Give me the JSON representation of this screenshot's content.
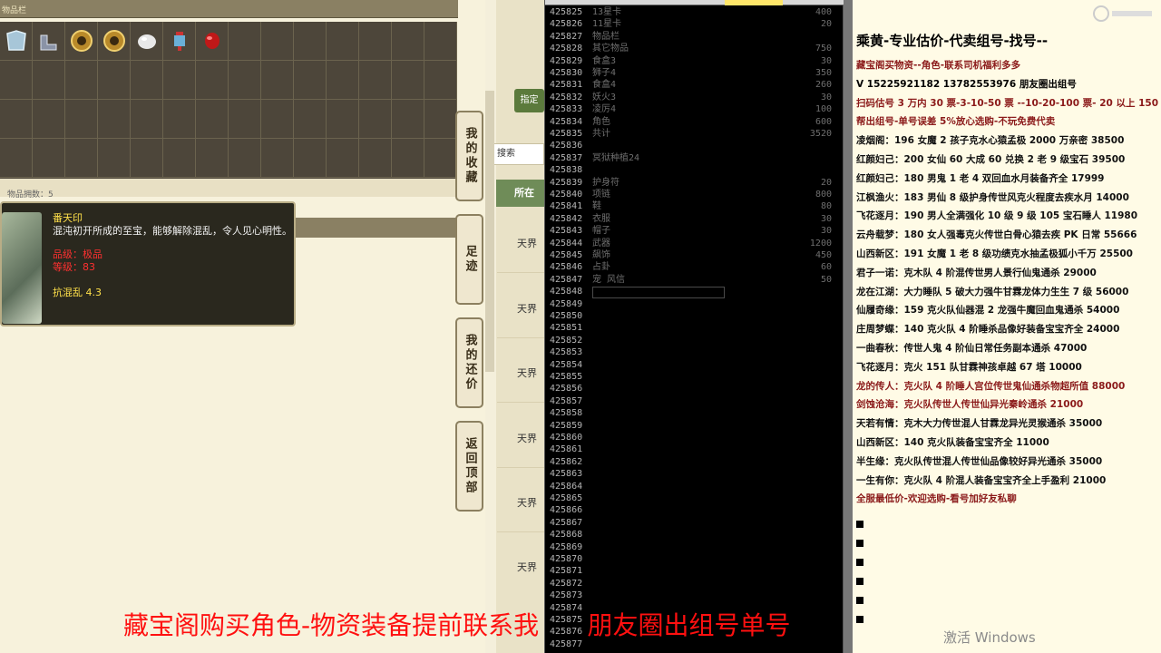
{
  "window": {
    "inventory_header": "物品栏",
    "strip_text": "物品拥数：5"
  },
  "tooltip": {
    "name": "番天印",
    "desc": "混沌初开所成的至宝，能够解除混乱，令人见心明性。",
    "req_a": "品级：极品",
    "req_b": "等级：83",
    "stat": "抗混乱 4.3"
  },
  "side_buttons": [
    "我的收藏",
    "足迹",
    "我的还价",
    "返回顶部"
  ],
  "partial_buttons": [
    "指定",
    "搜索"
  ],
  "col_label": "所在",
  "row_label": "天界",
  "spreadsheet": {
    "rows": [
      {
        "n": "425825",
        "t": "13星卡",
        "v": "400"
      },
      {
        "n": "425826",
        "t": "11星卡",
        "v": "20"
      },
      {
        "n": "425827",
        "t": "物品栏",
        "v": ""
      },
      {
        "n": "425828",
        "t": "其它物品",
        "v": "750"
      },
      {
        "n": "425829",
        "t": "食盒3",
        "v": "30"
      },
      {
        "n": "425830",
        "t": "狮子4",
        "v": "350"
      },
      {
        "n": "425831",
        "t": "食盒4",
        "v": "260"
      },
      {
        "n": "425832",
        "t": "妖火3",
        "v": "30"
      },
      {
        "n": "425833",
        "t": "凌厉4",
        "v": "100"
      },
      {
        "n": "425834",
        "t": "角色",
        "v": "600"
      },
      {
        "n": "425835",
        "t": "共计",
        "v": "3520"
      },
      {
        "n": "425836",
        "t": "",
        "v": ""
      },
      {
        "n": "425837",
        "t": "冥狱种植24",
        "v": ""
      },
      {
        "n": "425838",
        "t": "",
        "v": ""
      },
      {
        "n": "425839",
        "t": "护身符",
        "v": "20"
      },
      {
        "n": "425840",
        "t": "项链",
        "v": "800"
      },
      {
        "n": "425841",
        "t": "鞋",
        "v": "80"
      },
      {
        "n": "425842",
        "t": "衣服",
        "v": "30"
      },
      {
        "n": "425843",
        "t": "帽子",
        "v": "30"
      },
      {
        "n": "425844",
        "t": "武器",
        "v": "1200"
      },
      {
        "n": "425845",
        "t": "飙饰",
        "v": "450"
      },
      {
        "n": "425846",
        "t": "占卦",
        "v": "60"
      },
      {
        "n": "425847",
        "t": "宠 风信",
        "v": "50"
      },
      {
        "n": "425848",
        "t": "",
        "v": ""
      },
      {
        "n": "425849",
        "t": "",
        "v": ""
      },
      {
        "n": "425850",
        "t": "",
        "v": ""
      },
      {
        "n": "425851",
        "t": "",
        "v": ""
      },
      {
        "n": "425852",
        "t": "",
        "v": ""
      },
      {
        "n": "425853",
        "t": "",
        "v": ""
      },
      {
        "n": "425854",
        "t": "",
        "v": ""
      },
      {
        "n": "425855",
        "t": "",
        "v": ""
      },
      {
        "n": "425856",
        "t": "",
        "v": ""
      },
      {
        "n": "425857",
        "t": "",
        "v": ""
      },
      {
        "n": "425858",
        "t": "",
        "v": ""
      },
      {
        "n": "425859",
        "t": "",
        "v": ""
      },
      {
        "n": "425860",
        "t": "",
        "v": ""
      },
      {
        "n": "425861",
        "t": "",
        "v": ""
      },
      {
        "n": "425862",
        "t": "",
        "v": ""
      },
      {
        "n": "425863",
        "t": "",
        "v": ""
      },
      {
        "n": "425864",
        "t": "",
        "v": ""
      },
      {
        "n": "425865",
        "t": "",
        "v": ""
      },
      {
        "n": "425866",
        "t": "",
        "v": ""
      },
      {
        "n": "425867",
        "t": "",
        "v": ""
      },
      {
        "n": "425868",
        "t": "",
        "v": ""
      },
      {
        "n": "425869",
        "t": "",
        "v": ""
      },
      {
        "n": "425870",
        "t": "",
        "v": ""
      },
      {
        "n": "425871",
        "t": "",
        "v": ""
      },
      {
        "n": "425872",
        "t": "",
        "v": ""
      },
      {
        "n": "425873",
        "t": "",
        "v": ""
      },
      {
        "n": "425874",
        "t": "",
        "v": ""
      },
      {
        "n": "425875",
        "t": "",
        "v": ""
      },
      {
        "n": "425876",
        "t": "",
        "v": ""
      },
      {
        "n": "425877",
        "t": "",
        "v": ""
      }
    ]
  },
  "right_panel": {
    "title": "乘黄-专业估价-代卖组号-找号--",
    "lines": [
      {
        "text": "藏宝阁买物资--角色-联系司机福利多多",
        "color": "#8b1a1a"
      },
      {
        "text": "V 15225921182   13782553976 朋友圈出组号",
        "color": "#000000"
      },
      {
        "text": "扫码估号 3 万内 30 票-3-10-50 票  --10-20-100 票- 20 以上 150",
        "color": "#8b1a1a"
      },
      {
        "text": "帮出组号-单号误差 5%放心选购-不玩免费代卖",
        "color": "#8b1a1a"
      },
      {
        "text": "凌烟阁：196 女魔 2 孩子克水心猿孟极 2000 万亲密 38500",
        "color": "#111111"
      },
      {
        "text": "红颜妇己：200 女仙 60 大成 60 兑换 2 老 9 级宝石 39500",
        "color": "#111111"
      },
      {
        "text": "红颜妇己：180 男鬼 1 老 4 双回血水月装备齐全 17999",
        "color": "#111111"
      },
      {
        "text": "江枫渔火：183 男仙 8 级护身传世风克火程度去疾水月 14000",
        "color": "#111111"
      },
      {
        "text": "飞花逐月：190 男人全满强化 10 级 9 级 105 宝石睡人 11980",
        "color": "#111111"
      },
      {
        "text": "云舟载梦：180 女人强毒克火传世白骨心猿去疾 PK 日常 55666",
        "color": "#111111"
      },
      {
        "text": "山西新区：191 女魔 1 老 8 级功绩克水抽孟极狐小千万 25500",
        "color": "#111111"
      },
      {
        "text": "君子一诺：克木队 4 阶混传世男人景行仙鬼通杀 29000",
        "color": "#111111"
      },
      {
        "text": "龙在江湖：大力睡队 5 破大力强牛甘霖龙体力生生 7 级 56000",
        "color": "#111111"
      },
      {
        "text": "仙履奇缘：159 克火队仙器混 2 龙强牛魔回血鬼通杀 54000",
        "color": "#111111"
      },
      {
        "text": "庄周梦蝶：140 克火队 4 阶睡杀品像好装备宝宝齐全 24000",
        "color": "#111111"
      },
      {
        "text": "一曲春秋：传世人鬼 4 阶仙日常任务副本通杀 47000",
        "color": "#111111"
      },
      {
        "text": "飞花逐月：克火 151 队甘霖神孩卓越 67 塔 10000",
        "color": "#111111"
      },
      {
        "text": "龙的传人：克火队 4 阶睡人宫位传世鬼仙通杀物超所值 88000",
        "color": "#8b1a1a"
      },
      {
        "text": "剑蚀沧海：克火队传世人传世仙异光秦岭通杀 21000",
        "color": "#8b1a1a"
      },
      {
        "text": "天若有情：克木大力传世混人甘霖龙异光灵猴通杀 35000",
        "color": "#111111"
      },
      {
        "text": "山西新区：140 克火队装备宝宝齐全 11000",
        "color": "#111111"
      },
      {
        "text": "半生缘：克火队传世混人传世仙品像较好异光通杀 35000",
        "color": "#111111"
      },
      {
        "text": "一生有你：克火队 4 阶混人装备宝宝齐全上手盈利 21000",
        "color": "#111111"
      },
      {
        "text": "全服最低价-欢迎选购-看号加好友私聊",
        "color": "#8b1a1a"
      }
    ]
  },
  "bottom": {
    "caption": "藏宝阁购买角色-物资装备提前联系我      朋友圈出组号单号",
    "watermark": "激活 Windows"
  },
  "colors": {
    "caption": "#ff1010",
    "inv_bg": "#4d463a",
    "tooltip_bg": "#2a281e"
  },
  "inventory_icons": [
    "armor-icon",
    "boots-icon",
    "coin-icon",
    "coin-icon",
    "pearl-icon",
    "lantern-icon",
    "gem-icon"
  ]
}
